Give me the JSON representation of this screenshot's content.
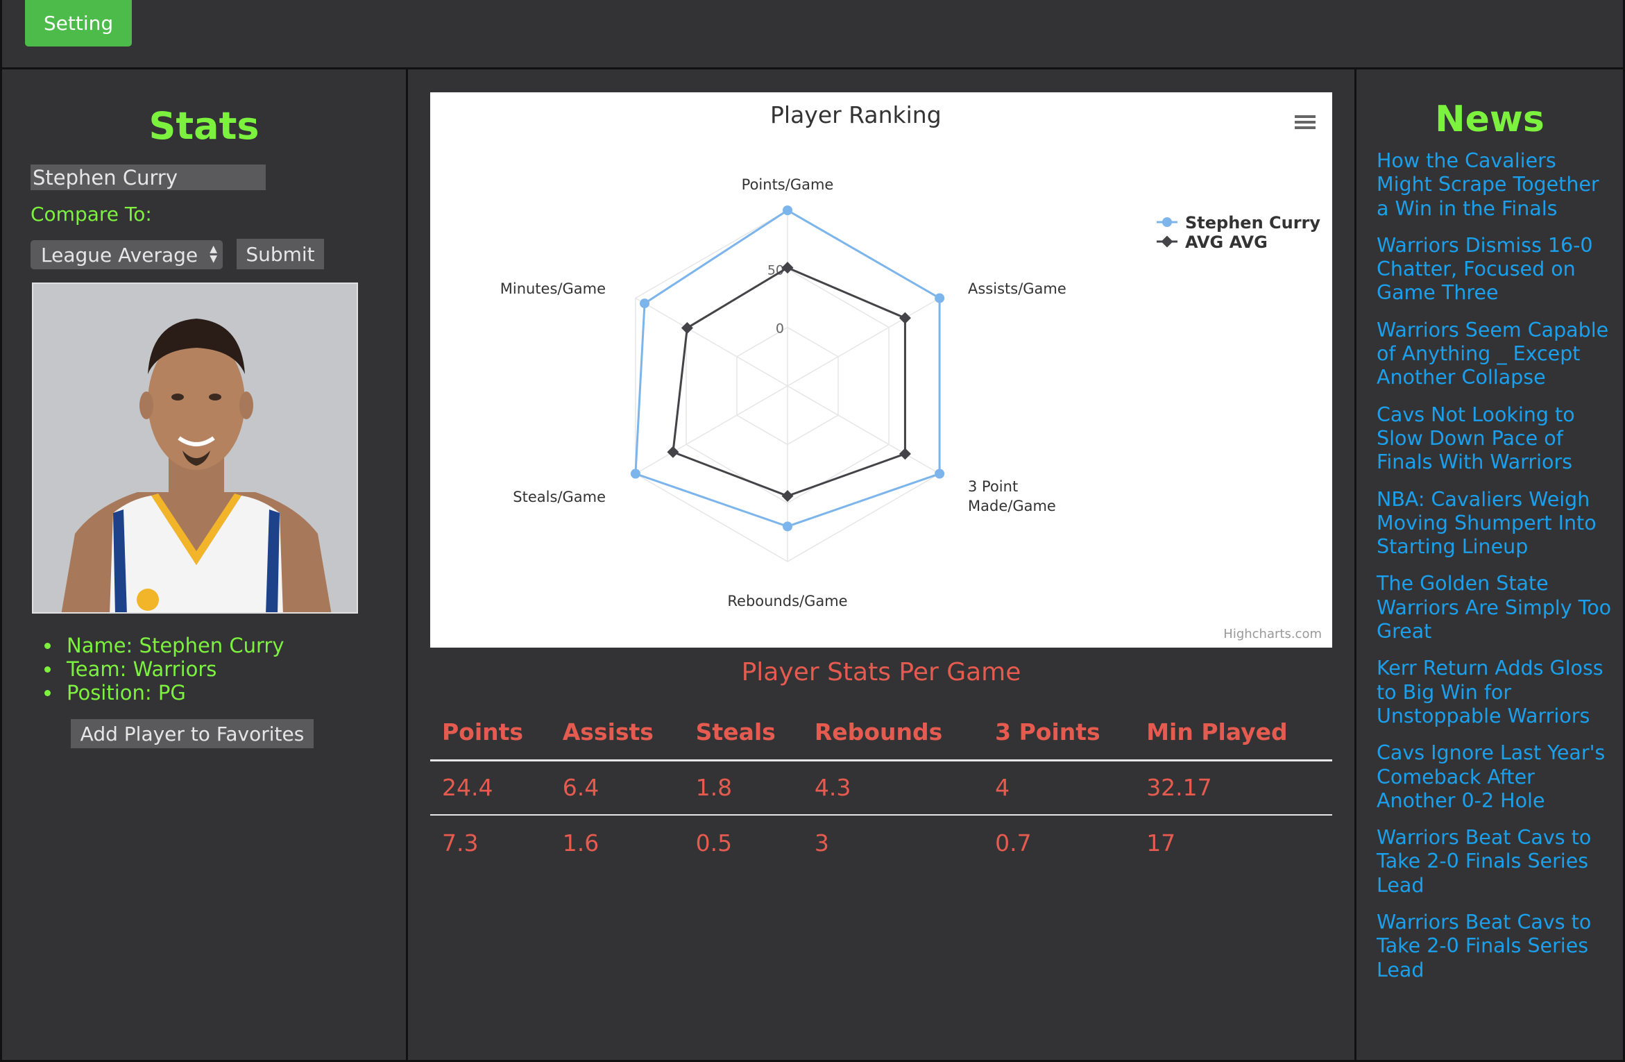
{
  "topbar": {
    "setting_label": "Setting"
  },
  "stats_panel": {
    "heading": "Stats",
    "player_input_value": "Stephen Curry",
    "compare_label": "Compare To:",
    "compare_select_value": "League Average",
    "submit_label": "Submit",
    "info": [
      "Name: Stephen Curry",
      "Team: Warriors",
      "Position: PG"
    ],
    "favorite_label": "Add Player to Favorites"
  },
  "chart_data": {
    "type": "radar",
    "title": "Player Ranking",
    "categories": [
      "Points/Game",
      "Assists/Game",
      "3 Point Made/Game",
      "Rebounds/Game",
      "Steals/Game",
      "Minutes/Game"
    ],
    "axis_ticks": [
      "0",
      "50"
    ],
    "ylim": [
      -50,
      100
    ],
    "series": [
      {
        "name": "Stephen Curry",
        "values": [
          100,
          100,
          100,
          70,
          100,
          91
        ],
        "color": "#7cb5ec"
      },
      {
        "name": "AVG AVG",
        "values": [
          51,
          66,
          66,
          44,
          63,
          49
        ],
        "color": "#434348"
      }
    ],
    "legend_placement": "top-right",
    "grid": true,
    "credit": "Highcharts.com",
    "menu_icon": "hamburger-icon"
  },
  "player_stats": {
    "title": "Player Stats Per Game",
    "columns": [
      "Points",
      "Assists",
      "Steals",
      "Rebounds",
      "3 Points",
      "Min Played"
    ],
    "rows": [
      [
        "24.4",
        "6.4",
        "1.8",
        "4.3",
        "4",
        "32.17"
      ],
      [
        "7.3",
        "1.6",
        "0.5",
        "3",
        "0.7",
        "17"
      ]
    ]
  },
  "news": {
    "heading": "News",
    "items": [
      "How the Cavaliers Might Scrape Together a Win in the Finals",
      "Warriors Dismiss 16-0 Chatter, Focused on Game Three",
      "Warriors Seem Capable of Anything _ Except Another Collapse",
      "Cavs Not Looking to Slow Down Pace of Finals With Warriors",
      "NBA: Cavaliers Weigh Moving Shumpert Into Starting Lineup",
      "The Golden State Warriors Are Simply Too Great",
      "Kerr Return Adds Gloss to Big Win for Unstoppable Warriors",
      "Cavs Ignore Last Year's Comeback After Another 0-2 Hole",
      "Warriors Beat Cavs to Take 2-0 Finals Series Lead",
      "Warriors Beat Cavs to Take 2-0 Finals Series Lead"
    ]
  },
  "colors": {
    "background": "#333335",
    "accent_green": "#7df23e",
    "button_green": "#4cbb4a",
    "stats_red": "#e55b4f",
    "news_blue": "#1aa0ec"
  }
}
